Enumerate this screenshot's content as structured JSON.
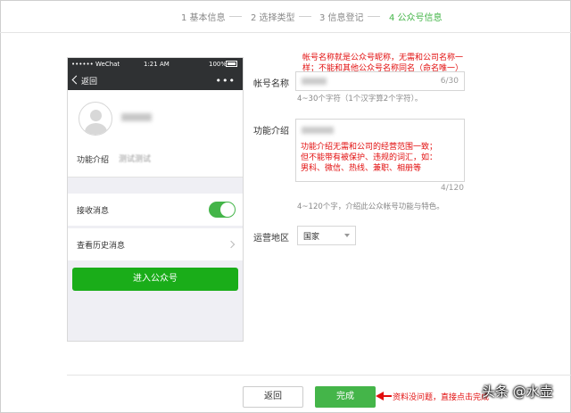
{
  "steps": [
    "1 基本信息",
    "2 选择类型",
    "3 信息登记",
    "4 公众号信息"
  ],
  "phone": {
    "carrier": "•••••• WeChat",
    "time": "1:21 AM",
    "battery": "100%",
    "back_label": "返回",
    "more": "•••",
    "intro_label": "功能介绍",
    "intro_value": "测试测试",
    "receive_label": "接收消息",
    "receive_on": true,
    "history_label": "查看历史消息",
    "enter_button": "进入公众号"
  },
  "form": {
    "name_label": "帐号名称",
    "name_counter": "6/30",
    "name_hint": "4~30个字符（1个汉字算2个字符）。",
    "name_note_line1": "帐号名称就是公众号昵称，无需和公司名称一",
    "name_note_line2": "样；不能和其他公众号名称同名（命名唯一）",
    "intro_label": "功能介绍",
    "intro_note_line1": "功能介绍无需和公司的经营范围一致；",
    "intro_note_line2": "但不能带有被保护、违规的词汇，如：",
    "intro_note_line3": "男科、微信、热线、兼职、相册等",
    "intro_counter": "4/120",
    "intro_hint": "4~120个字，介绍此公众帐号功能与特色。",
    "region_label": "运营地区",
    "region_value": "国家"
  },
  "footer": {
    "back_button": "返回",
    "done_button": "完成",
    "note": "资料没问题，直接点击完成",
    "watermark": "头条 @水壶"
  },
  "colors": {
    "accent": "#44b549",
    "annotation": "#e20e0e",
    "phone_bar": "#2f3133"
  }
}
